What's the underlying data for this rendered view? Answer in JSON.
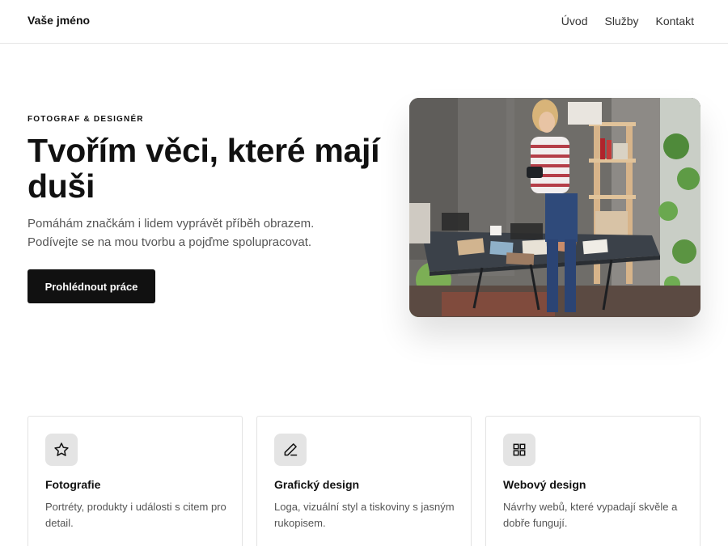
{
  "brand": "Vaše jméno",
  "nav": {
    "items": [
      "Úvod",
      "Služby",
      "Kontakt"
    ]
  },
  "hero": {
    "eyebrow": "FOTOGRAF & DESIGNÉR",
    "title": "Tvořím věci, které mají duši",
    "subtitle": "Pomáhám značkám i lidem vyprávět příběh obrazem. Podívejte se na mou tvorbu a pojďme spolupracovat.",
    "cta_label": "Prohlédnout práce"
  },
  "services": [
    {
      "icon": "star-icon",
      "title": "Fotografie",
      "text": "Portréty, produkty i události s citem pro detail."
    },
    {
      "icon": "pencil-icon",
      "title": "Grafický design",
      "text": "Loga, vizuální styl a tiskoviny s jasným rukopisem."
    },
    {
      "icon": "grid-icon",
      "title": "Webový design",
      "text": "Návrhy webů, které vypadají skvěle a dobře fungují."
    }
  ],
  "colors": {
    "primary": "#111111",
    "text_muted": "#555555",
    "icon_bg": "#e4e4e4",
    "border": "#e3e3e3"
  }
}
